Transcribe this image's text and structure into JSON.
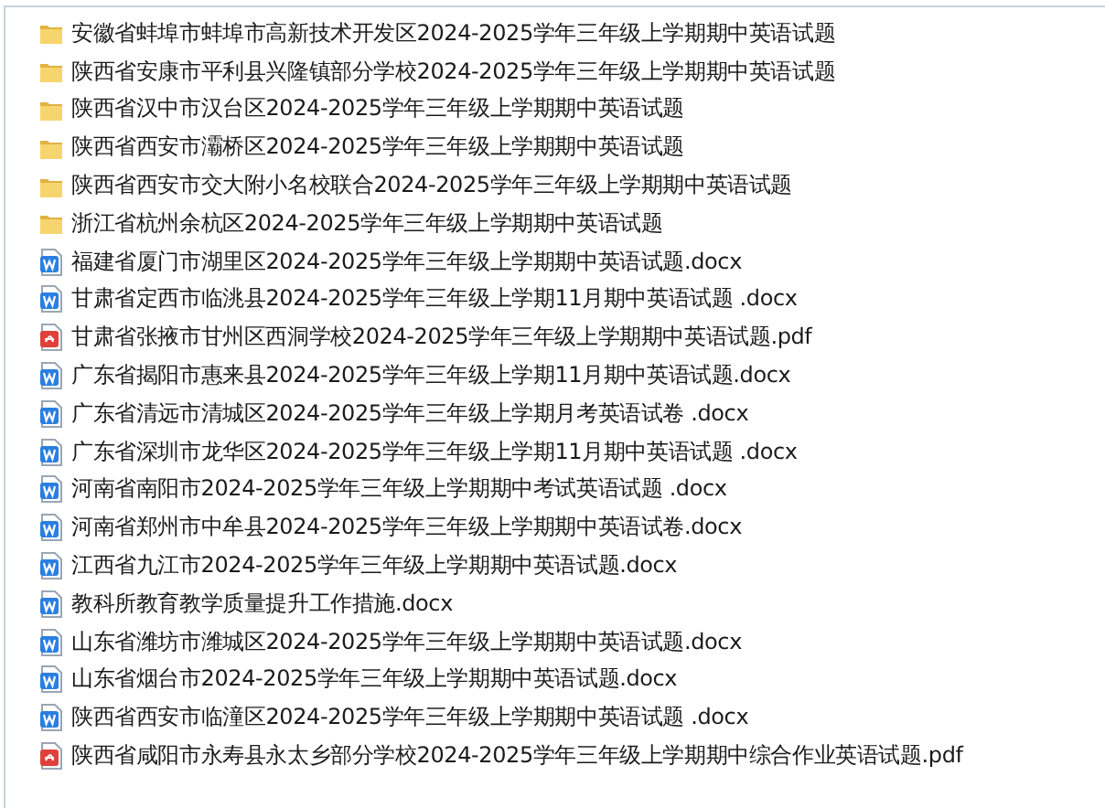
{
  "files": [
    {
      "kind": "folder",
      "name": "安徽省蚌埠市蚌埠市高新技术开发区2024-2025学年三年级上学期期中英语试题"
    },
    {
      "kind": "folder",
      "name": "陕西省安康市平利县兴隆镇部分学校2024-2025学年三年级上学期期中英语试题"
    },
    {
      "kind": "folder",
      "name": "陕西省汉中市汉台区2024-2025学年三年级上学期期中英语试题"
    },
    {
      "kind": "folder",
      "name": "陕西省西安市灞桥区2024-2025学年三年级上学期期中英语试题"
    },
    {
      "kind": "folder",
      "name": "陕西省西安市交大附小名校联合2024-2025学年三年级上学期期中英语试题"
    },
    {
      "kind": "folder",
      "name": "浙江省杭州余杭区2024-2025学年三年级上学期期中英语试题"
    },
    {
      "kind": "docx",
      "name": "福建省厦门市湖里区2024-2025学年三年级上学期期中英语试题.docx"
    },
    {
      "kind": "docx",
      "name": "甘肃省定西市临洮县2024-2025学年三年级上学期11月期中英语试题 .docx"
    },
    {
      "kind": "pdf",
      "name": "甘肃省张掖市甘州区西洞学校2024-2025学年三年级上学期期中英语试题.pdf"
    },
    {
      "kind": "docx",
      "name": "广东省揭阳市惠来县2024-2025学年三年级上学期11月期中英语试题.docx"
    },
    {
      "kind": "docx",
      "name": "广东省清远市清城区2024-2025学年三年级上学期月考英语试卷 .docx"
    },
    {
      "kind": "docx",
      "name": "广东省深圳市龙华区2024-2025学年三年级上学期11月期中英语试题 .docx"
    },
    {
      "kind": "docx",
      "name": "河南省南阳市2024-2025学年三年级上学期期中考试英语试题 .docx"
    },
    {
      "kind": "docx",
      "name": "河南省郑州市中牟县2024-2025学年三年级上学期期中英语试卷.docx"
    },
    {
      "kind": "docx",
      "name": "江西省九江市2024-2025学年三年级上学期期中英语试题.docx"
    },
    {
      "kind": "docx",
      "name": "教科所教育教学质量提升工作措施.docx"
    },
    {
      "kind": "docx",
      "name": "山东省潍坊市潍城区2024-2025学年三年级上学期期中英语试题.docx"
    },
    {
      "kind": "docx",
      "name": "山东省烟台市2024-2025学年三年级上学期期中英语试题.docx"
    },
    {
      "kind": "docx",
      "name": "陕西省西安市临潼区2024-2025学年三年级上学期期中英语试题 .docx"
    },
    {
      "kind": "pdf",
      "name": "陕西省咸阳市永寿县永太乡部分学校2024-2025学年三年级上学期期中综合作业英语试题.pdf"
    }
  ]
}
